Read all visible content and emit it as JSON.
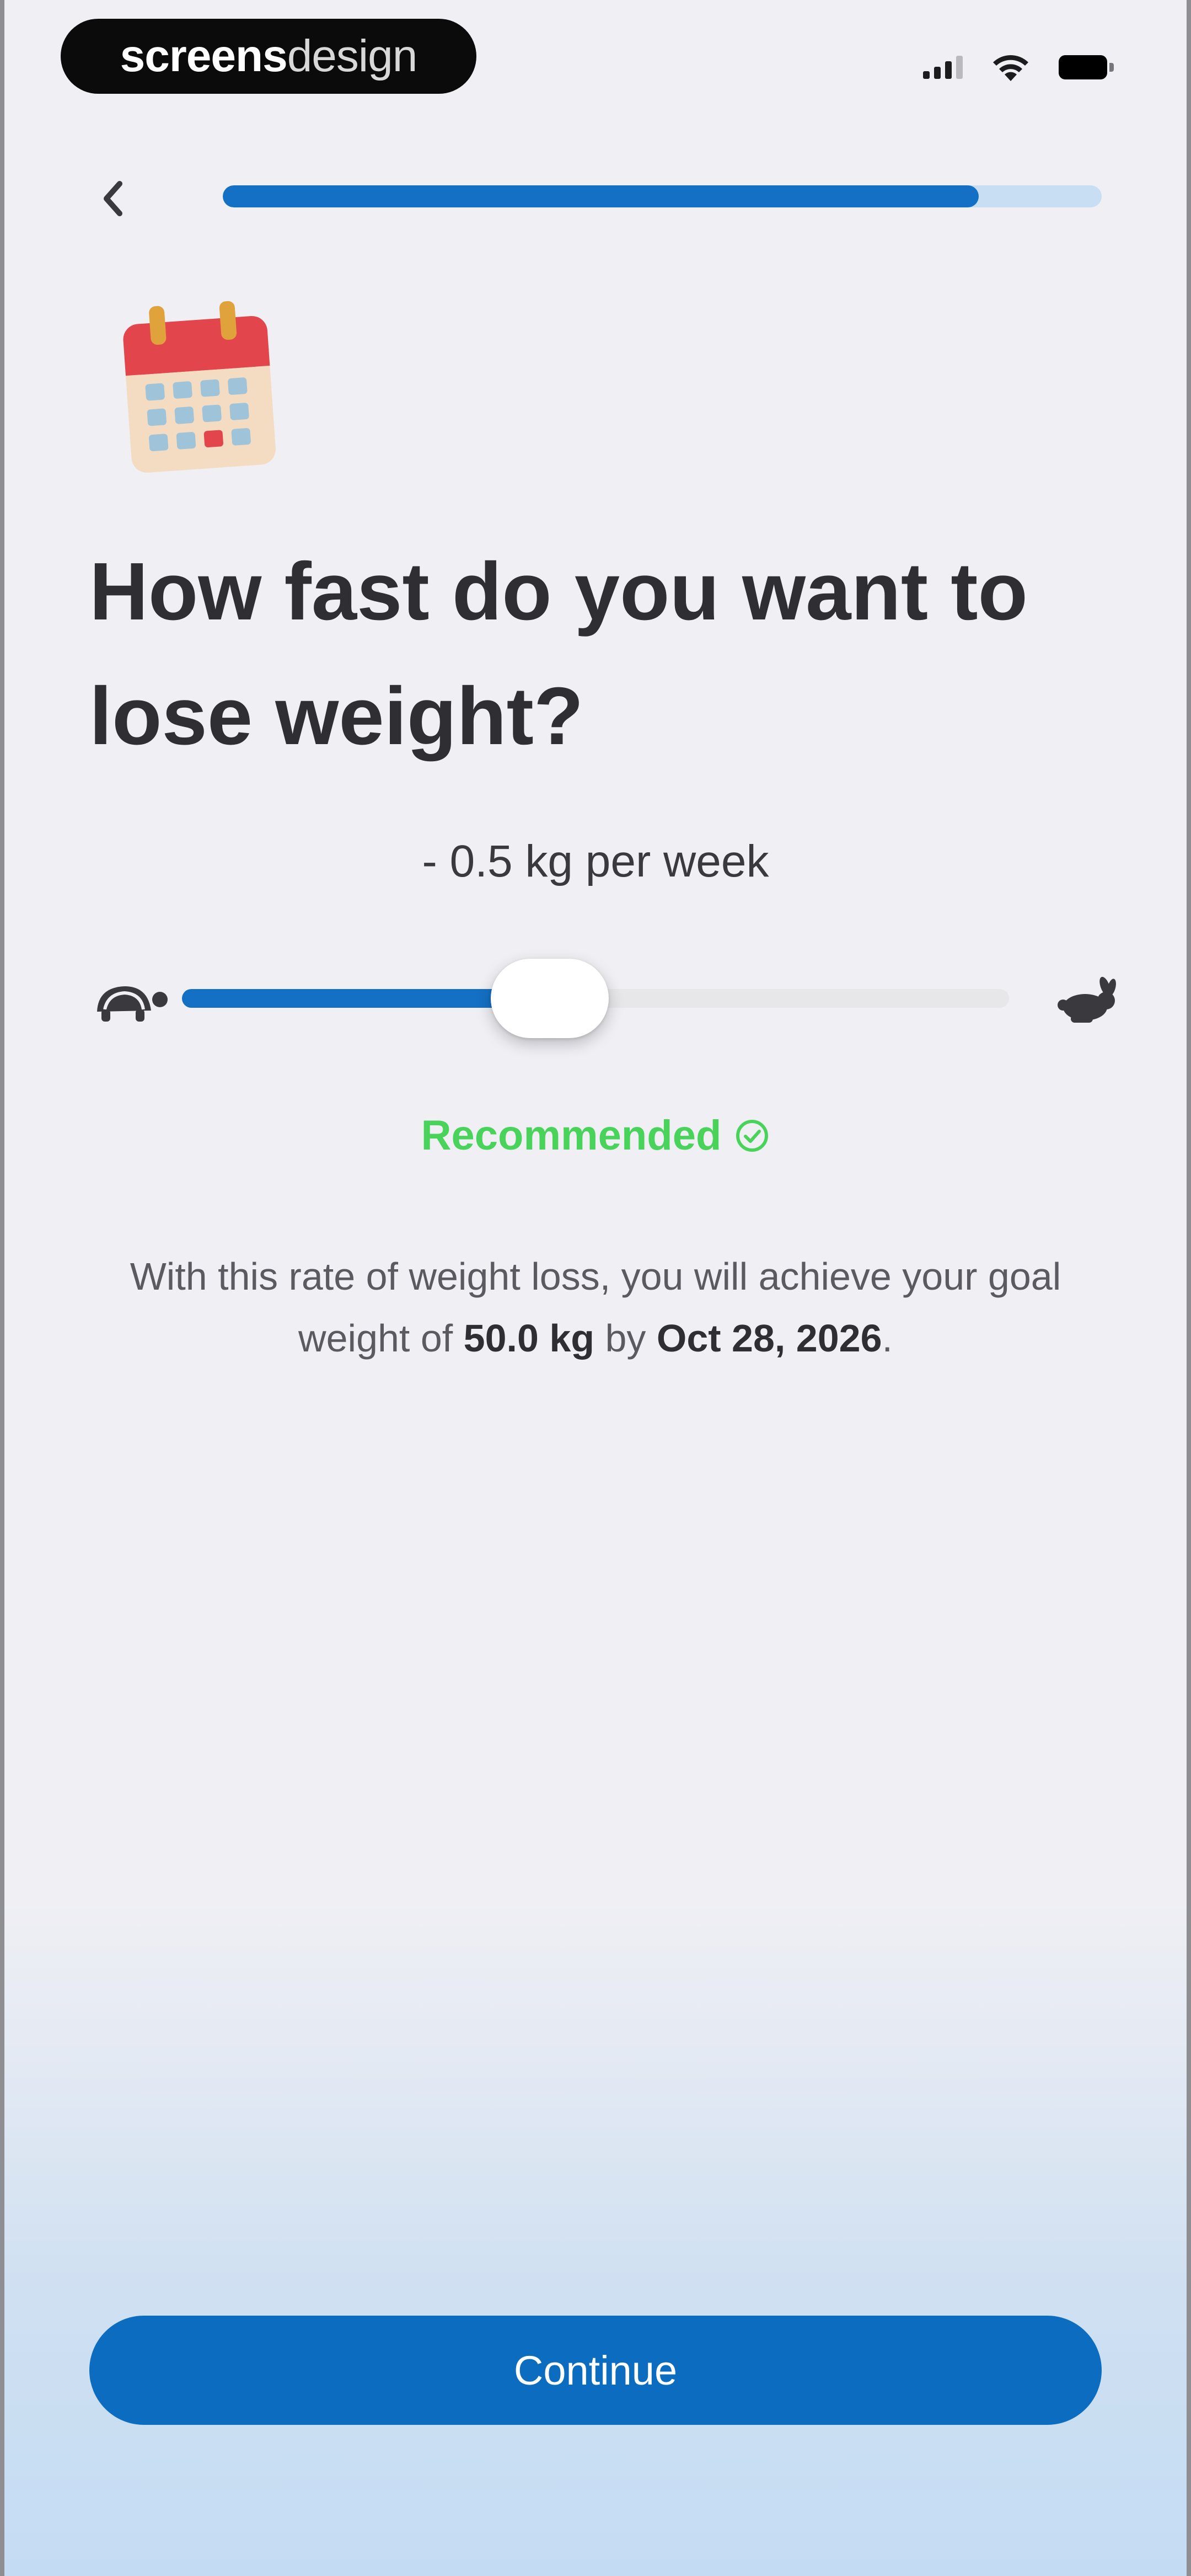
{
  "status_bar": {
    "brand_bold": "screens",
    "brand_light": "design",
    "signal_icon": "cellular-signal-icon",
    "wifi_icon": "wifi-icon",
    "battery_icon": "battery-icon"
  },
  "nav": {
    "back_icon": "chevron-left-icon",
    "progress": 0.86
  },
  "header": {
    "icon": "calendar-emoji-icon",
    "title": "How fast do you want to lose weight?"
  },
  "rate": {
    "label": "- 0.5 kg per week",
    "slider_value": 0.5,
    "slider_min": 0.1,
    "slider_max": 1.0,
    "slow_icon": "turtle-icon",
    "fast_icon": "rabbit-icon"
  },
  "recommendation": {
    "label": "Recommended",
    "icon": "check-circle-icon"
  },
  "info": {
    "text_1": "With this rate of weight loss, you will achieve your goal weight of ",
    "goal_weight": "50.0 kg",
    "text_2": " by ",
    "goal_date": "Oct 28, 2026",
    "text_3": "."
  },
  "footer": {
    "continue_label": "Continue"
  },
  "colors": {
    "accent": "#1470c4",
    "button": "#0b6cc0",
    "recommended": "#49d35a",
    "background": "#efeff4"
  }
}
